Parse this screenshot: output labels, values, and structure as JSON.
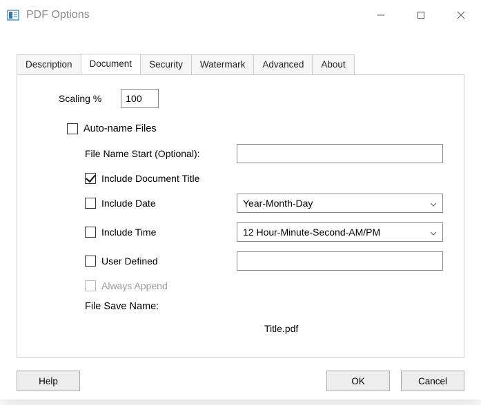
{
  "window": {
    "title": "PDF Options"
  },
  "tabs": {
    "items": [
      "Description",
      "Document",
      "Security",
      "Watermark",
      "Advanced",
      "About"
    ],
    "active": "Document"
  },
  "document": {
    "scaling_label": "Scaling %",
    "scaling_value": "100",
    "auto_name_label": "Auto-name Files",
    "auto_name_checked": false,
    "file_name_start_label": "File Name Start (Optional):",
    "file_name_start_value": "",
    "include_title_label": "Include Document Title",
    "include_title_checked": true,
    "include_date_label": "Include Date",
    "include_date_checked": false,
    "date_format": "Year-Month-Day",
    "include_time_label": "Include Time",
    "include_time_checked": false,
    "time_format": "12 Hour-Minute-Second-AM/PM",
    "user_defined_label": "User Defined",
    "user_defined_checked": false,
    "user_defined_value": "",
    "always_append_label": "Always Append",
    "always_append_enabled": false,
    "file_save_name_label": "File Save Name:",
    "file_save_name_value": "Title.pdf"
  },
  "buttons": {
    "help": "Help",
    "ok": "OK",
    "cancel": "Cancel"
  }
}
